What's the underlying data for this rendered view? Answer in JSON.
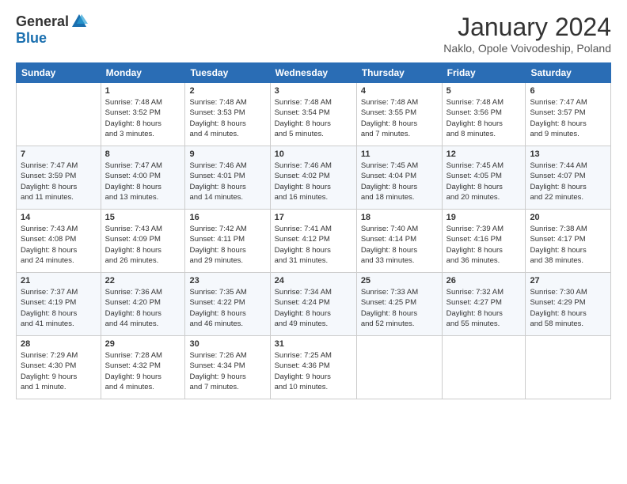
{
  "logo": {
    "general": "General",
    "blue": "Blue"
  },
  "title": "January 2024",
  "subtitle": "Naklo, Opole Voivodeship, Poland",
  "weekdays": [
    "Sunday",
    "Monday",
    "Tuesday",
    "Wednesday",
    "Thursday",
    "Friday",
    "Saturday"
  ],
  "weeks": [
    [
      {
        "day": "",
        "sunrise": "",
        "sunset": "",
        "daylight": ""
      },
      {
        "day": "1",
        "sunrise": "Sunrise: 7:48 AM",
        "sunset": "Sunset: 3:52 PM",
        "daylight": "Daylight: 8 hours and 3 minutes."
      },
      {
        "day": "2",
        "sunrise": "Sunrise: 7:48 AM",
        "sunset": "Sunset: 3:53 PM",
        "daylight": "Daylight: 8 hours and 4 minutes."
      },
      {
        "day": "3",
        "sunrise": "Sunrise: 7:48 AM",
        "sunset": "Sunset: 3:54 PM",
        "daylight": "Daylight: 8 hours and 5 minutes."
      },
      {
        "day": "4",
        "sunrise": "Sunrise: 7:48 AM",
        "sunset": "Sunset: 3:55 PM",
        "daylight": "Daylight: 8 hours and 7 minutes."
      },
      {
        "day": "5",
        "sunrise": "Sunrise: 7:48 AM",
        "sunset": "Sunset: 3:56 PM",
        "daylight": "Daylight: 8 hours and 8 minutes."
      },
      {
        "day": "6",
        "sunrise": "Sunrise: 7:47 AM",
        "sunset": "Sunset: 3:57 PM",
        "daylight": "Daylight: 8 hours and 9 minutes."
      }
    ],
    [
      {
        "day": "7",
        "sunrise": "Sunrise: 7:47 AM",
        "sunset": "Sunset: 3:59 PM",
        "daylight": "Daylight: 8 hours and 11 minutes."
      },
      {
        "day": "8",
        "sunrise": "Sunrise: 7:47 AM",
        "sunset": "Sunset: 4:00 PM",
        "daylight": "Daylight: 8 hours and 13 minutes."
      },
      {
        "day": "9",
        "sunrise": "Sunrise: 7:46 AM",
        "sunset": "Sunset: 4:01 PM",
        "daylight": "Daylight: 8 hours and 14 minutes."
      },
      {
        "day": "10",
        "sunrise": "Sunrise: 7:46 AM",
        "sunset": "Sunset: 4:02 PM",
        "daylight": "Daylight: 8 hours and 16 minutes."
      },
      {
        "day": "11",
        "sunrise": "Sunrise: 7:45 AM",
        "sunset": "Sunset: 4:04 PM",
        "daylight": "Daylight: 8 hours and 18 minutes."
      },
      {
        "day": "12",
        "sunrise": "Sunrise: 7:45 AM",
        "sunset": "Sunset: 4:05 PM",
        "daylight": "Daylight: 8 hours and 20 minutes."
      },
      {
        "day": "13",
        "sunrise": "Sunrise: 7:44 AM",
        "sunset": "Sunset: 4:07 PM",
        "daylight": "Daylight: 8 hours and 22 minutes."
      }
    ],
    [
      {
        "day": "14",
        "sunrise": "Sunrise: 7:43 AM",
        "sunset": "Sunset: 4:08 PM",
        "daylight": "Daylight: 8 hours and 24 minutes."
      },
      {
        "day": "15",
        "sunrise": "Sunrise: 7:43 AM",
        "sunset": "Sunset: 4:09 PM",
        "daylight": "Daylight: 8 hours and 26 minutes."
      },
      {
        "day": "16",
        "sunrise": "Sunrise: 7:42 AM",
        "sunset": "Sunset: 4:11 PM",
        "daylight": "Daylight: 8 hours and 29 minutes."
      },
      {
        "day": "17",
        "sunrise": "Sunrise: 7:41 AM",
        "sunset": "Sunset: 4:12 PM",
        "daylight": "Daylight: 8 hours and 31 minutes."
      },
      {
        "day": "18",
        "sunrise": "Sunrise: 7:40 AM",
        "sunset": "Sunset: 4:14 PM",
        "daylight": "Daylight: 8 hours and 33 minutes."
      },
      {
        "day": "19",
        "sunrise": "Sunrise: 7:39 AM",
        "sunset": "Sunset: 4:16 PM",
        "daylight": "Daylight: 8 hours and 36 minutes."
      },
      {
        "day": "20",
        "sunrise": "Sunrise: 7:38 AM",
        "sunset": "Sunset: 4:17 PM",
        "daylight": "Daylight: 8 hours and 38 minutes."
      }
    ],
    [
      {
        "day": "21",
        "sunrise": "Sunrise: 7:37 AM",
        "sunset": "Sunset: 4:19 PM",
        "daylight": "Daylight: 8 hours and 41 minutes."
      },
      {
        "day": "22",
        "sunrise": "Sunrise: 7:36 AM",
        "sunset": "Sunset: 4:20 PM",
        "daylight": "Daylight: 8 hours and 44 minutes."
      },
      {
        "day": "23",
        "sunrise": "Sunrise: 7:35 AM",
        "sunset": "Sunset: 4:22 PM",
        "daylight": "Daylight: 8 hours and 46 minutes."
      },
      {
        "day": "24",
        "sunrise": "Sunrise: 7:34 AM",
        "sunset": "Sunset: 4:24 PM",
        "daylight": "Daylight: 8 hours and 49 minutes."
      },
      {
        "day": "25",
        "sunrise": "Sunrise: 7:33 AM",
        "sunset": "Sunset: 4:25 PM",
        "daylight": "Daylight: 8 hours and 52 minutes."
      },
      {
        "day": "26",
        "sunrise": "Sunrise: 7:32 AM",
        "sunset": "Sunset: 4:27 PM",
        "daylight": "Daylight: 8 hours and 55 minutes."
      },
      {
        "day": "27",
        "sunrise": "Sunrise: 7:30 AM",
        "sunset": "Sunset: 4:29 PM",
        "daylight": "Daylight: 8 hours and 58 minutes."
      }
    ],
    [
      {
        "day": "28",
        "sunrise": "Sunrise: 7:29 AM",
        "sunset": "Sunset: 4:30 PM",
        "daylight": "Daylight: 9 hours and 1 minute."
      },
      {
        "day": "29",
        "sunrise": "Sunrise: 7:28 AM",
        "sunset": "Sunset: 4:32 PM",
        "daylight": "Daylight: 9 hours and 4 minutes."
      },
      {
        "day": "30",
        "sunrise": "Sunrise: 7:26 AM",
        "sunset": "Sunset: 4:34 PM",
        "daylight": "Daylight: 9 hours and 7 minutes."
      },
      {
        "day": "31",
        "sunrise": "Sunrise: 7:25 AM",
        "sunset": "Sunset: 4:36 PM",
        "daylight": "Daylight: 9 hours and 10 minutes."
      },
      {
        "day": "",
        "sunrise": "",
        "sunset": "",
        "daylight": ""
      },
      {
        "day": "",
        "sunrise": "",
        "sunset": "",
        "daylight": ""
      },
      {
        "day": "",
        "sunrise": "",
        "sunset": "",
        "daylight": ""
      }
    ]
  ]
}
